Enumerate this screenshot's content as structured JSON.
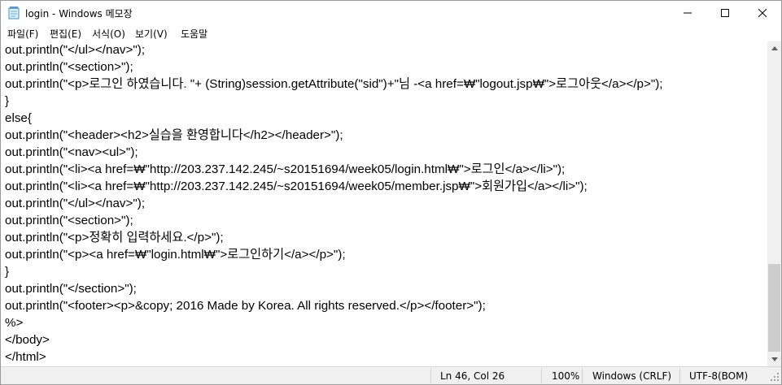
{
  "window": {
    "title": "login - Windows 메모장",
    "controls": {
      "minimize": "minimize",
      "maximize": "maximize",
      "close": "close"
    }
  },
  "menu": [
    "파일(F)",
    "편집(E)",
    "서식(O)",
    "보기(V)",
    "도움말"
  ],
  "editor": {
    "lines": [
      "out.println(\"</ul></nav>\");",
      "out.println(\"<section>\");",
      "out.println(\"<p>로그인 하였습니다. \"+ (String)session.getAttribute(\"sid\")+\"님 -<a href=₩\"logout.jsp₩\">로그아웃</a></p>\");",
      "}",
      "else{",
      "out.println(\"<header><h2>실습을 환영합니다</h2></header>\");",
      "out.println(\"<nav><ul>\");",
      "out.println(\"<li><a href=₩\"http://203.237.142.245/~s20151694/week05/login.html₩\">로그인</a></li>\");",
      "out.println(\"<li><a href=₩\"http://203.237.142.245/~s20151694/week05/member.jsp₩\">회원가입</a></li>\");",
      "out.println(\"</ul></nav>\");",
      "out.println(\"<section>\");",
      "out.println(\"<p>정확히 입력하세요.</p>\");",
      "out.println(\"<p><a href=₩\"login.html₩\">로그인하기</a></p>\");",
      "}",
      "out.println(\"</section>\");",
      "out.println(\"<footer><p>&copy; 2016 Made by Korea. All rights reserved.</p></footer>\");",
      "%>",
      "</body>",
      "</html>"
    ]
  },
  "status": {
    "position": "Ln 46, Col 26",
    "zoom": "100%",
    "line_ending": "Windows (CRLF)",
    "encoding": "UTF-8(BOM)"
  },
  "scrollbar": {
    "position_fraction": 0.7
  }
}
